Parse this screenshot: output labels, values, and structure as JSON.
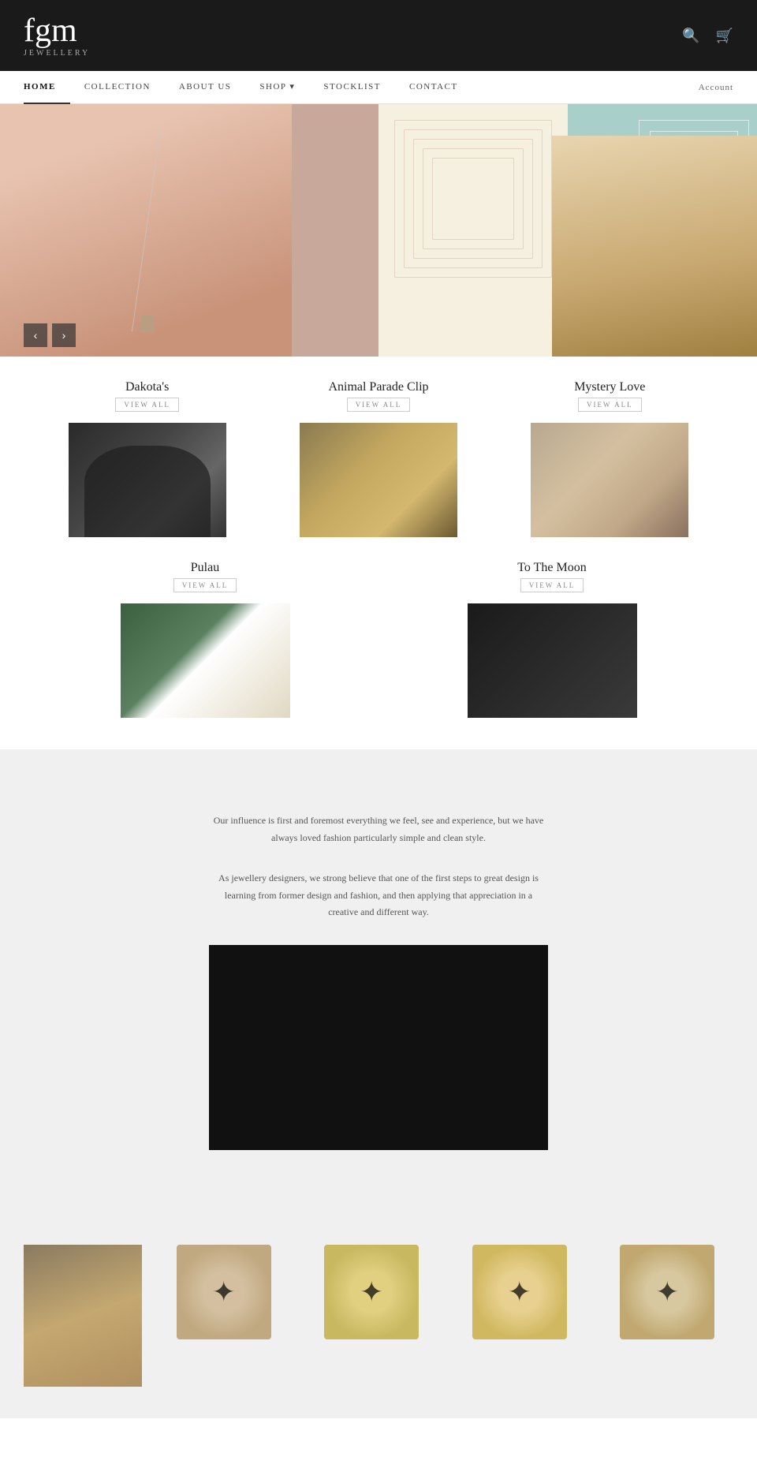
{
  "brand": {
    "name": "fgm",
    "subtitle": "JEWELLERY"
  },
  "header": {
    "search_icon": "🔍",
    "cart_icon": "🛒"
  },
  "nav": {
    "items": [
      {
        "label": "HOME",
        "active": true
      },
      {
        "label": "COLLECTION",
        "active": false
      },
      {
        "label": "ABOUT US",
        "active": false
      },
      {
        "label": "SHOP",
        "active": false,
        "has_dropdown": true
      },
      {
        "label": "STOCKLIST",
        "active": false
      },
      {
        "label": "CONTACT",
        "active": false
      }
    ],
    "account_label": "Account"
  },
  "hero": {
    "prev_label": "‹",
    "next_label": "›"
  },
  "collections": {
    "row1": [
      {
        "name": "Dakota's",
        "view_all": "VIEW ALL"
      },
      {
        "name": "Animal Parade Clip",
        "view_all": "VIEW ALL"
      },
      {
        "name": "Mystery Love",
        "view_all": "VIEW ALL"
      }
    ],
    "row2": [
      {
        "name": "Pulau",
        "view_all": "VIEW ALL"
      },
      {
        "name": "To The Moon",
        "view_all": "VIEW ALL"
      }
    ]
  },
  "about": {
    "text1": "Our influence is first and foremost everything we feel, see and experience, but we have always loved fashion particularly simple and clean style.",
    "text2": "As jewellery designers, we strong believe that one of the first steps to great design is learning from former design and fashion, and then applying that appreciation in a creative and different way."
  }
}
